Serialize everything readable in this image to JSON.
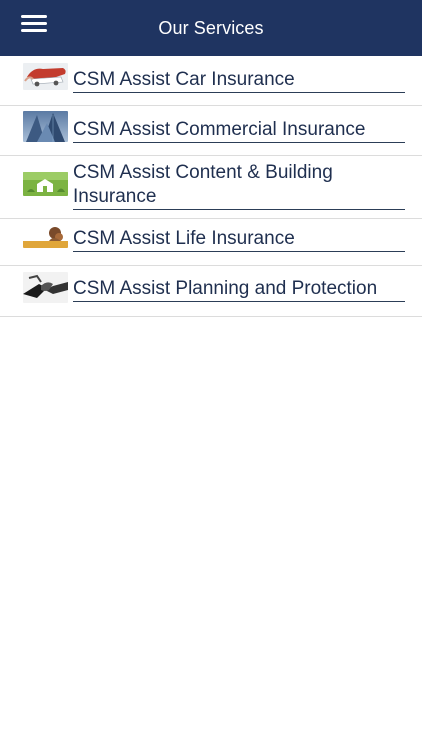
{
  "header": {
    "title": "Our Services",
    "menu_icon": "hamburger-menu-icon",
    "background": "#1f3461"
  },
  "services": [
    {
      "label": "CSM Assist Car Insurance",
      "thumb": "car-insurance-thumbnail"
    },
    {
      "label": "CSM Assist Commercial Insurance",
      "thumb": "commercial-buildings-thumbnail"
    },
    {
      "label": "CSM Assist Content & Building Insurance",
      "thumb": "house-on-grass-thumbnail"
    },
    {
      "label": "CSM Assist Life Insurance",
      "thumb": "life-insurance-thumbnail"
    },
    {
      "label": "CSM Assist Planning and Protection",
      "thumb": "handshake-thumbnail"
    }
  ],
  "colors": {
    "text": "#1f2f4f",
    "divider": "#dcdcdc",
    "underline": "#2c3e57"
  }
}
